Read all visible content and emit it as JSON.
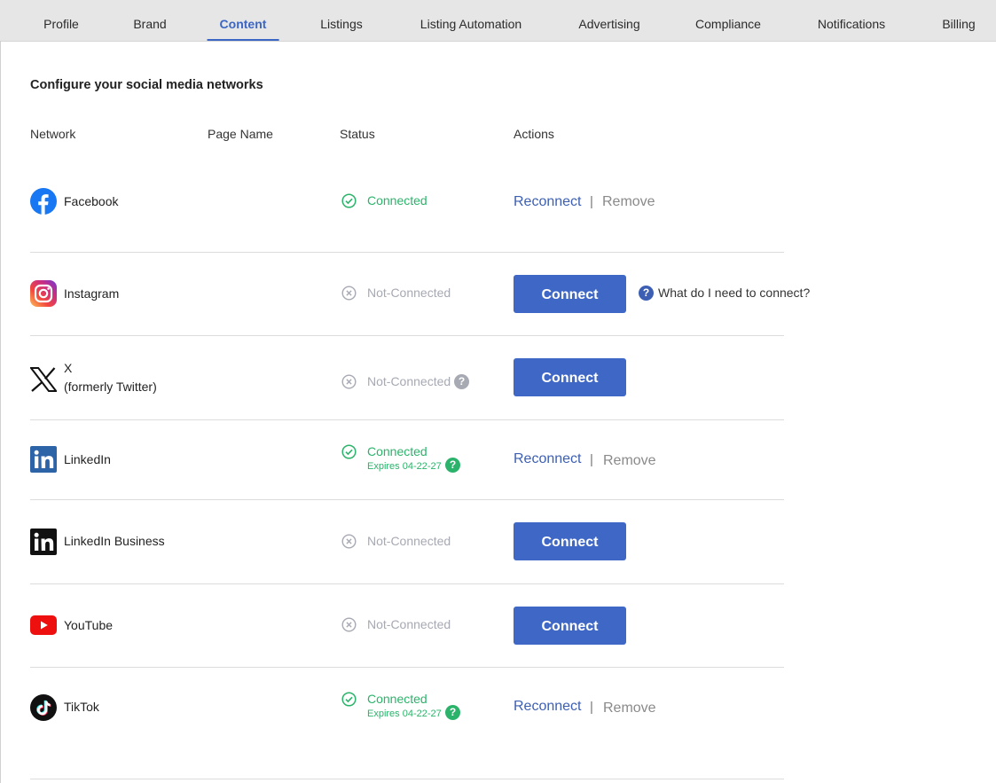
{
  "tabs": [
    {
      "label": "Profile",
      "active": false
    },
    {
      "label": "Brand",
      "active": false
    },
    {
      "label": "Content",
      "active": true
    },
    {
      "label": "Listings",
      "active": false
    },
    {
      "label": "Listing Automation",
      "active": false
    },
    {
      "label": "Advertising",
      "active": false
    },
    {
      "label": "Compliance",
      "active": false
    },
    {
      "label": "Notifications",
      "active": false
    },
    {
      "label": "Billing",
      "active": false
    }
  ],
  "section": {
    "title": "Configure your social media networks"
  },
  "columns": {
    "network": "Network",
    "page_name": "Page Name",
    "status": "Status",
    "actions": "Actions"
  },
  "colors": {
    "accent": "#3f67c6",
    "connected": "#2cb36b",
    "not_connected": "#a7a9b3"
  },
  "networks": [
    {
      "name": "Facebook",
      "icon": "facebook-icon",
      "status": "Connected",
      "action": "reconnect"
    },
    {
      "name": "Instagram",
      "icon": "instagram-icon",
      "status": "Not-Connected",
      "action": "connect",
      "help": "What do I need to connect?"
    },
    {
      "name": "X",
      "subname": "(formerly Twitter)",
      "icon": "x-icon",
      "status": "Not-Connected",
      "action": "connect"
    },
    {
      "name": "LinkedIn",
      "icon": "linkedin-icon",
      "status": "Connected",
      "expires": "Expires 04-22-27",
      "action": "reconnect"
    },
    {
      "name": "LinkedIn Business",
      "icon": "linkedin-business-icon",
      "status": "Not-Connected",
      "action": "connect"
    },
    {
      "name": "YouTube",
      "icon": "youtube-icon",
      "status": "Not-Connected",
      "action": "connect"
    },
    {
      "name": "TikTok",
      "icon": "tiktok-icon",
      "status": "Connected",
      "expires": "Expires 04-22-27",
      "action": "reconnect"
    }
  ],
  "actions": {
    "reconnect": "Reconnect",
    "separator": "|",
    "remove": "Remove",
    "connect": "Connect"
  }
}
